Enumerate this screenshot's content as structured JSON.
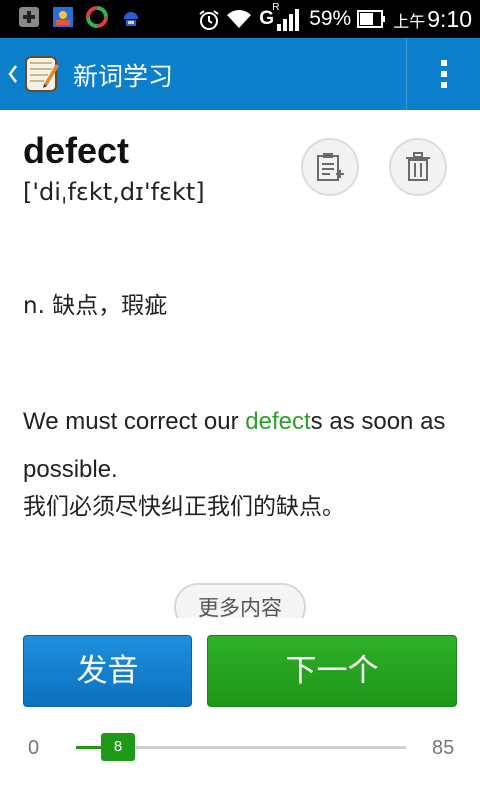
{
  "status_bar": {
    "signal_label": "G",
    "signal_sub": "R",
    "battery_percent": "59%",
    "time_prefix": "上午",
    "time": "9:10",
    "icons": [
      "add-box-icon",
      "photo-app-icon",
      "sync-app-icon",
      "android-debug-icon",
      "alarm-icon",
      "wifi-icon",
      "signal-icon",
      "battery-icon"
    ]
  },
  "action_bar": {
    "title": "新词学习",
    "icons": [
      "back-chevron-icon",
      "wordbook-app-icon",
      "overflow-menu-icon"
    ],
    "color": "#0b7fcc"
  },
  "word": {
    "headword": "defect",
    "phonetic": "['diˌfɛkt,dɪ'fɛkt]",
    "definition": "n. 缺点，瑕疵",
    "example_pre": "We must correct our ",
    "example_highlight": "defect",
    "example_post": "s as soon as possible.",
    "translation": "我们必须尽快纠正我们的缺点。",
    "highlight_color": "#2ca02c"
  },
  "actions": {
    "add_icon": "add-to-notebook-icon",
    "delete_icon": "trash-icon",
    "more_label": "更多内容",
    "pronounce_label": "发音",
    "next_label": "下一个"
  },
  "progress": {
    "min": "0",
    "max": "85",
    "current": "8",
    "fraction": 0.094,
    "color": "#1e9a18"
  }
}
